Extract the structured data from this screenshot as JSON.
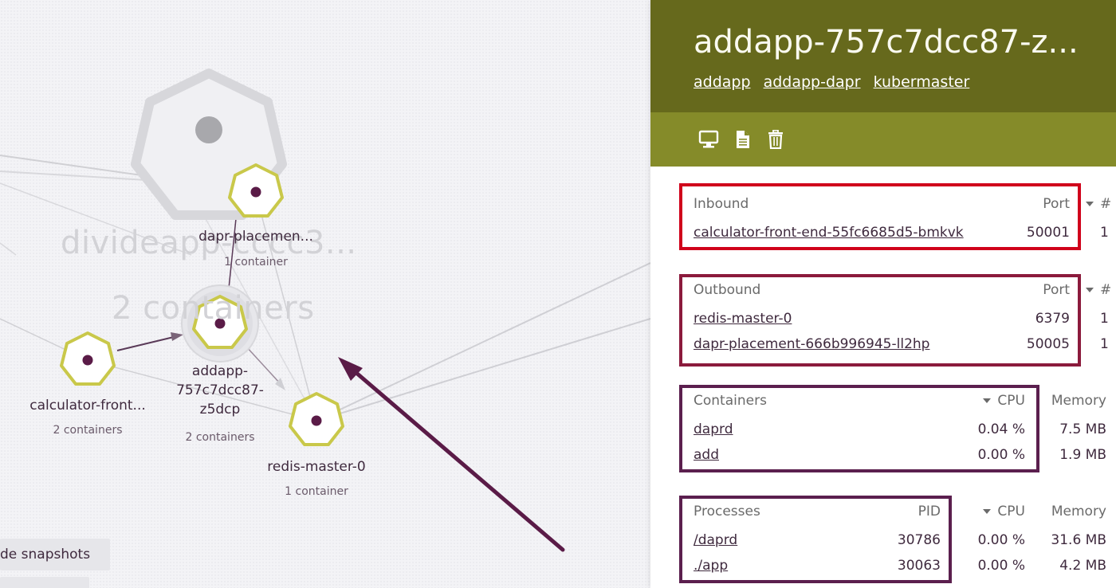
{
  "graph": {
    "group_label": "divideapp-cccc3...",
    "group_sub": "2 containers",
    "nodes": [
      {
        "name": "dapr-placemen...",
        "sub": "1 container"
      },
      {
        "name_lines": [
          "addapp-",
          "757c7dcc87-",
          "z5dcp"
        ],
        "sub": "2 containers"
      },
      {
        "name": "calculator-front...",
        "sub": "2 containers"
      },
      {
        "name": "redis-master-0",
        "sub": "1 container"
      }
    ],
    "snapshots_label": "de snapshots"
  },
  "panel": {
    "title": "addapp-757c7dcc87-z...",
    "links": [
      "addapp",
      "addapp-dapr",
      "kubermaster"
    ],
    "toolbar": {
      "icons": [
        "monitor-icon",
        "document-icon",
        "trash-icon"
      ]
    },
    "colors": {
      "header": "#66691c",
      "toolbar": "#858b29",
      "inbound_box": "#d0021b",
      "outbound_box": "#8b1a3c",
      "containers_box": "#5b1f4e"
    },
    "inbound": {
      "title": "Inbound",
      "port_header": "Port",
      "count_header": "#",
      "rows": [
        {
          "name": "calculator-front-end-55fc6685d5-bmkvk",
          "port": "50001",
          "count": "1"
        }
      ]
    },
    "outbound": {
      "title": "Outbound",
      "port_header": "Port",
      "count_header": "#",
      "rows": [
        {
          "name": "redis-master-0",
          "port": "6379",
          "count": "1"
        },
        {
          "name": "dapr-placement-666b996945-ll2hp",
          "port": "50005",
          "count": "1"
        }
      ]
    },
    "containers": {
      "title": "Containers",
      "cpu_header": "CPU",
      "memory_header": "Memory",
      "rows": [
        {
          "name": "daprd",
          "cpu": "0.04 %",
          "memory": "7.5 MB"
        },
        {
          "name": "add",
          "cpu": "0.00 %",
          "memory": "1.9 MB"
        }
      ]
    },
    "processes": {
      "title": "Processes",
      "pid_header": "PID",
      "cpu_header": "CPU",
      "memory_header": "Memory",
      "rows": [
        {
          "name": "/daprd",
          "pid": "30786",
          "cpu": "0.00 %",
          "memory": "31.6 MB"
        },
        {
          "name": "./app",
          "pid": "30063",
          "cpu": "0.00 %",
          "memory": "4.2 MB"
        }
      ]
    }
  }
}
